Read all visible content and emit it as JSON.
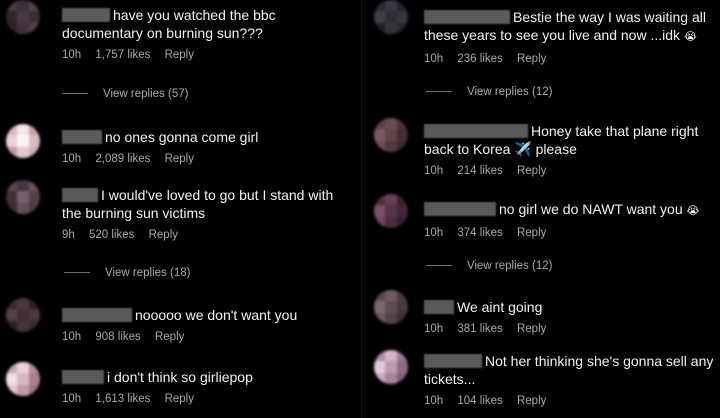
{
  "comments_left": [
    {
      "text": "have you watched the bbc documentary on burning sun???",
      "time": "10h",
      "likes": "1,757 likes",
      "reply": "Reply",
      "avatar_colors": [
        "#4a3a44",
        "#3b2f38",
        "#55404e",
        "#2f262d",
        "#463842",
        "#3a2e36",
        "#2d242b",
        "#3f323b",
        "#503d49"
      ]
    },
    {
      "text": "no ones gonna come girl",
      "time": "10h",
      "likes": "2,089 likes",
      "reply": "Reply",
      "avatar_colors": [
        "#d9b9bd",
        "#f2e6e8",
        "#c9a6ab",
        "#e8d3d6",
        "#fbf4f5",
        "#d7bcc0",
        "#bf9aa0",
        "#e2c9cc",
        "#cfb0b5"
      ]
    },
    {
      "text": "I would've loved to go but I stand with the burning sun victims",
      "time": "9h",
      "likes": "520 likes",
      "reply": "Reply",
      "avatar_colors": [
        "#5c4650",
        "#473740",
        "#6a5460",
        "#3f3038",
        "#765f6b",
        "#514049",
        "#3a2c33",
        "#60505a",
        "#4d3c45"
      ]
    },
    {
      "text": "nooooo we don't want you",
      "time": "10h",
      "likes": "908 likes",
      "reply": "Reply",
      "avatar_colors": [
        "#3a2a30",
        "#4b3640",
        "#2e2227",
        "#55404a",
        "#3f2e36",
        "#4a3840",
        "#2c2025",
        "#443239",
        "#382a30"
      ]
    },
    {
      "text": "i don't think so girliepop",
      "time": "10h",
      "likes": "1,613 likes",
      "reply": "Reply",
      "avatar_colors": [
        "#c8a7b2",
        "#e9d2da",
        "#b38e9b",
        "#f1dfe6",
        "#d7b8c3",
        "#a97f8e",
        "#e0c7d0",
        "#c09aa8",
        "#9c7584"
      ]
    }
  ],
  "view_replies_left": [
    {
      "label": "View replies (57)"
    },
    {
      "label": "View replies (18)"
    }
  ],
  "comments_right": [
    {
      "text": "Bestie the way I was waiting all these years to see you live and now ...idk",
      "emoji": "😭",
      "time": "10h",
      "likes": "236 likes",
      "reply": "Reply",
      "avatar_colors": [
        "#2c2a2e",
        "#3a3740",
        "#25232a",
        "#413d47",
        "#2f2c34",
        "#38353e",
        "#222026",
        "#35323a",
        "#2a282f"
      ]
    },
    {
      "text": "Honey take that plane right back to Korea ✈️ please",
      "time": "10h",
      "likes": "214 likes",
      "reply": "Reply",
      "avatar_colors": [
        "#5a4044",
        "#6b4c52",
        "#4a3438",
        "#7a5960",
        "#5e454a",
        "#432f33",
        "#684d52",
        "#52393e",
        "#3c2a2e"
      ]
    },
    {
      "text": "no girl we do NAWT want you",
      "emoji": "😭",
      "time": "10h",
      "likes": "374 likes",
      "reply": "Reply",
      "avatar_colors": [
        "#4e2f3c",
        "#66405a",
        "#3a2230",
        "#7a4f6a",
        "#553548",
        "#42283a",
        "#6e4660",
        "#4a2c3e",
        "#35202c"
      ]
    },
    {
      "text": "We aint going",
      "time": "10h",
      "likes": "381 likes",
      "reply": "Reply",
      "avatar_colors": [
        "#5a4a4e",
        "#6e5c60",
        "#4a3c40",
        "#7c6a6e",
        "#5e4e52",
        "#463a3e",
        "#685a5e",
        "#52444a",
        "#3e3236"
      ]
    },
    {
      "text": "Not her thinking she's gonna sell any tickets...",
      "time": "10h",
      "likes": "104 likes",
      "reply": "Reply",
      "avatar_colors": [
        "#b08ea4",
        "#d1b5c8",
        "#9c7a90",
        "#e0c9d8",
        "#bc9cb1",
        "#8e6d82",
        "#c9aabf",
        "#a5849a",
        "#7f6074"
      ]
    }
  ],
  "view_replies_right": [
    {
      "label": "View replies (12)"
    },
    {
      "label": "View replies (12)"
    }
  ]
}
